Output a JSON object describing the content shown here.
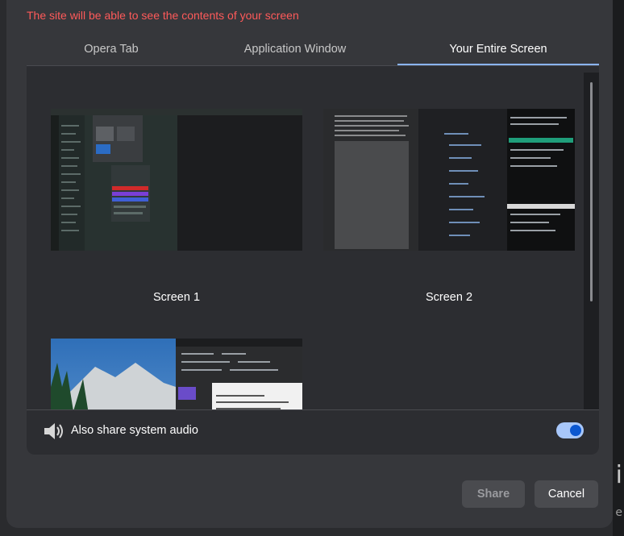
{
  "dialog": {
    "warning": "The site will be able to see the contents of your screen",
    "tabs": [
      {
        "label": "Opera Tab",
        "active": false
      },
      {
        "label": "Application Window",
        "active": false
      },
      {
        "label": "Your Entire Screen",
        "active": true
      }
    ],
    "screens": [
      {
        "label": "Screen 1"
      },
      {
        "label": "Screen 2"
      },
      {
        "label": ""
      }
    ],
    "audio": {
      "label": "Also share system audio",
      "enabled": true
    },
    "buttons": {
      "share": "Share",
      "cancel": "Cancel"
    }
  },
  "colors": {
    "warning": "#ff5a5a",
    "accent": "#8ab4f8",
    "toggle_track": "#a8c7fa",
    "toggle_knob": "#0b57d0"
  }
}
